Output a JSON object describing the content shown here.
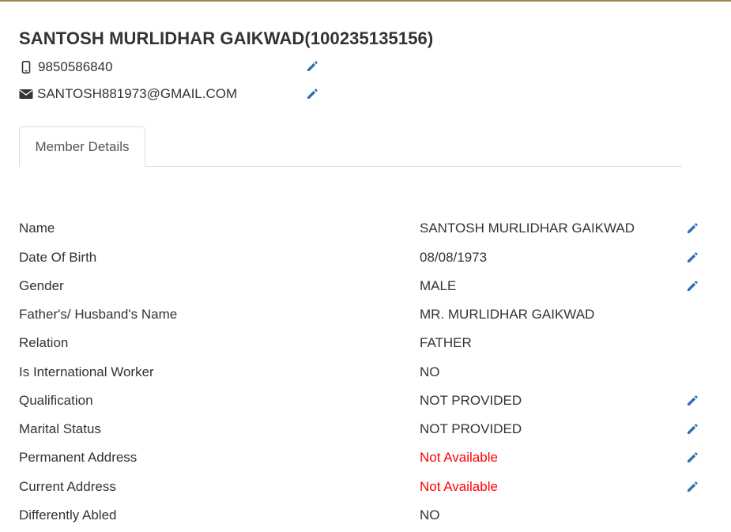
{
  "header": {
    "title": "SANTOSH MURLIDHAR GAIKWAD(100235135156)",
    "phone": "9850586840",
    "email": "SANTOSH881973@GMAIL.COM"
  },
  "tabs": [
    {
      "label": "Member Details",
      "active": true
    }
  ],
  "details": [
    {
      "label": "Name",
      "value": "SANTOSH MURLIDHAR GAIKWAD",
      "editable": true
    },
    {
      "label": "Date Of Birth",
      "value": "08/08/1973",
      "editable": true
    },
    {
      "label": "Gender",
      "value": "MALE",
      "editable": true
    },
    {
      "label": "Father's/ Husband's Name",
      "value": "MR. MURLIDHAR GAIKWAD",
      "editable": false
    },
    {
      "label": "Relation",
      "value": "FATHER",
      "editable": false
    },
    {
      "label": "Is International Worker",
      "value": "NO",
      "editable": false
    },
    {
      "label": "Qualification",
      "value": "NOT PROVIDED",
      "editable": true
    },
    {
      "label": "Marital Status",
      "value": "NOT PROVIDED",
      "editable": true
    },
    {
      "label": "Permanent Address",
      "value": "Not Available",
      "editable": true,
      "highlight": "red"
    },
    {
      "label": "Current Address",
      "value": "Not Available",
      "editable": true,
      "highlight": "red"
    },
    {
      "label": "Differently Abled",
      "value": "NO",
      "editable": false
    }
  ],
  "colors": {
    "accent_border": "#9c8a4f",
    "edit_icon": "#2f6fb3",
    "warning_text": "#ff0000"
  },
  "icons": {
    "phone": "mobile-phone-icon",
    "email": "envelope-icon",
    "edit": "pencil-icon"
  }
}
